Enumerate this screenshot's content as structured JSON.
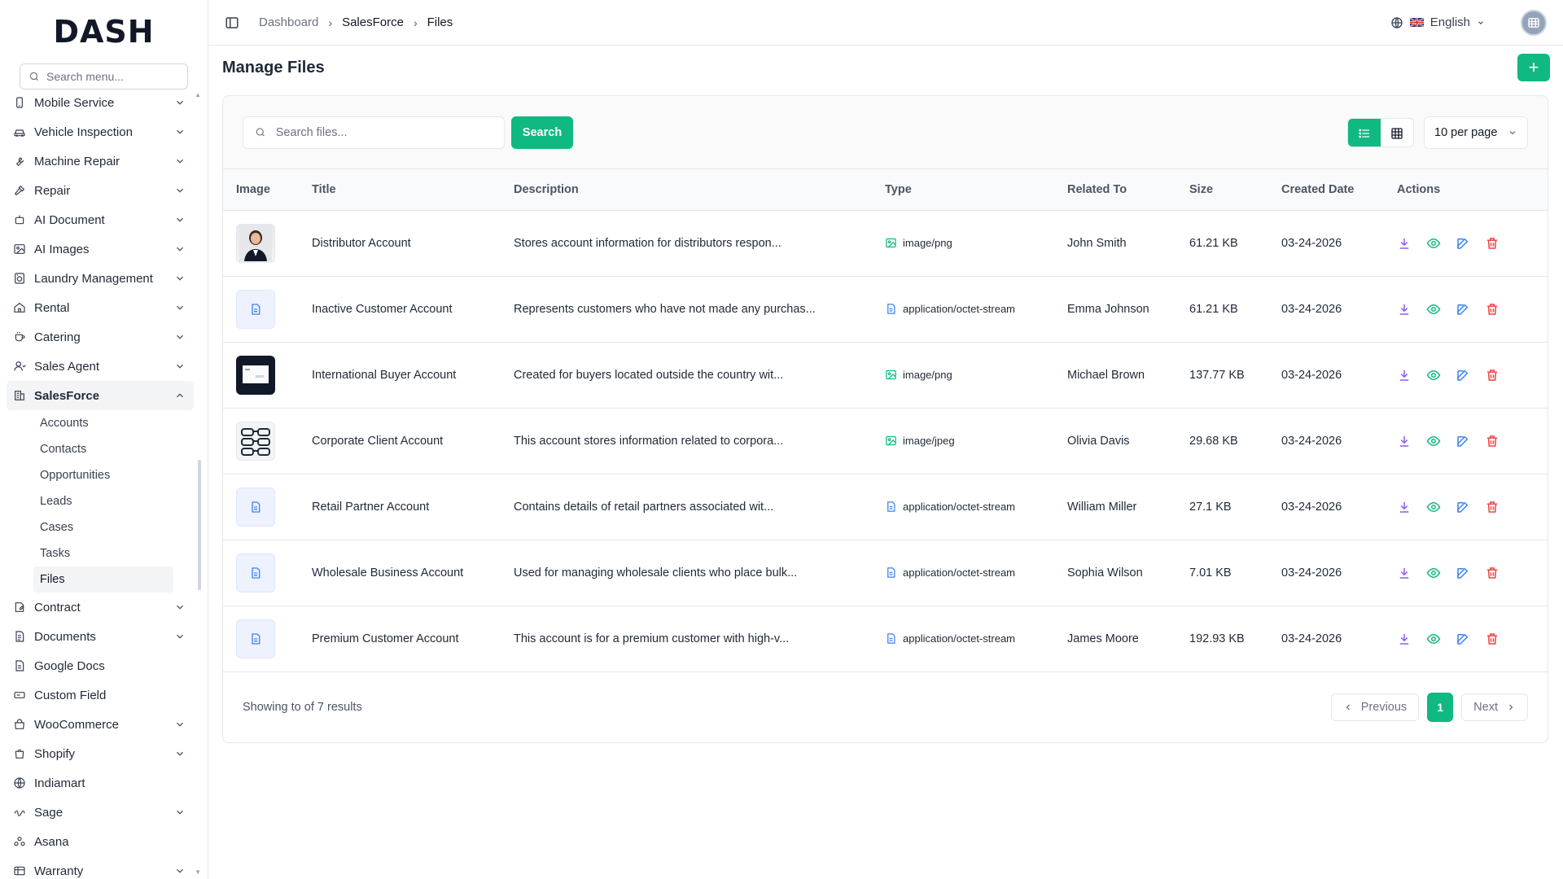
{
  "brand": {
    "logo_text": "DASH"
  },
  "sidebar": {
    "search_placeholder": "Search menu...",
    "items": [
      {
        "label": "Mobile Service",
        "icon": "phone-icon",
        "chevron": true
      },
      {
        "label": "Vehicle Inspection",
        "icon": "car-icon",
        "chevron": true
      },
      {
        "label": "Machine Repair",
        "icon": "wrench-icon",
        "chevron": true
      },
      {
        "label": "Repair",
        "icon": "hammer-icon",
        "chevron": true
      },
      {
        "label": "AI Document",
        "icon": "robot-icon",
        "chevron": true
      },
      {
        "label": "AI Images",
        "icon": "image-icon",
        "chevron": true
      },
      {
        "label": "Laundry Management",
        "icon": "washer-icon",
        "chevron": true
      },
      {
        "label": "Rental",
        "icon": "home-icon",
        "chevron": true
      },
      {
        "label": "Catering",
        "icon": "cup-icon",
        "chevron": true
      },
      {
        "label": "Sales Agent",
        "icon": "user-icon",
        "chevron": true
      },
      {
        "label": "SalesForce",
        "icon": "building-icon",
        "chevron": true,
        "expanded": true
      }
    ],
    "salesforce_sub": [
      "Accounts",
      "Contacts",
      "Opportunities",
      "Leads",
      "Cases",
      "Tasks",
      "Files"
    ],
    "items_after": [
      {
        "label": "Contract",
        "icon": "contract-icon",
        "chevron": true
      },
      {
        "label": "Documents",
        "icon": "document-icon",
        "chevron": true
      },
      {
        "label": "Google Docs",
        "icon": "doc-icon",
        "chevron": false
      },
      {
        "label": "Custom Field",
        "icon": "field-icon",
        "chevron": false
      },
      {
        "label": "WooCommerce",
        "icon": "store-icon",
        "chevron": true
      },
      {
        "label": "Shopify",
        "icon": "bag-icon",
        "chevron": true
      },
      {
        "label": "Indiamart",
        "icon": "globe-icon",
        "chevron": false
      },
      {
        "label": "Sage",
        "icon": "sage-icon",
        "chevron": true
      },
      {
        "label": "Asana",
        "icon": "asana-icon",
        "chevron": false
      },
      {
        "label": "Warranty",
        "icon": "warranty-icon",
        "chevron": true
      }
    ]
  },
  "topbar": {
    "breadcrumb": [
      "Dashboard",
      "SalesForce",
      "Files"
    ],
    "language": "English"
  },
  "page": {
    "title": "Manage Files",
    "add_label": "+"
  },
  "toolbar": {
    "search_placeholder": "Search files...",
    "search_label": "Search",
    "per_page": "10 per page"
  },
  "table": {
    "headers": [
      "Image",
      "Title",
      "Description",
      "Type",
      "Related To",
      "Size",
      "Created Date",
      "Actions"
    ],
    "rows": [
      {
        "thumb": "person",
        "title": "Distributor Account",
        "description": "Stores account information for distributors respon...",
        "type": "image/png",
        "type_icon": "image",
        "related": "John Smith",
        "size": "61.21 KB",
        "date": "03-24-2026"
      },
      {
        "thumb": "doc",
        "title": "Inactive Customer Account",
        "description": "Represents customers who have not made any purchas...",
        "type": "application/octet-stream",
        "type_icon": "file",
        "related": "Emma Johnson",
        "size": "61.21 KB",
        "date": "03-24-2026"
      },
      {
        "thumb": "screen",
        "title": "International Buyer Account",
        "description": "Created for buyers located outside the country wit...",
        "type": "image/png",
        "type_icon": "image",
        "related": "Michael Brown",
        "size": "137.77 KB",
        "date": "03-24-2026"
      },
      {
        "thumb": "glasses",
        "title": "Corporate Client Account",
        "description": "This account stores information related to corpora...",
        "type": "image/jpeg",
        "type_icon": "image",
        "related": "Olivia Davis",
        "size": "29.68 KB",
        "date": "03-24-2026"
      },
      {
        "thumb": "doc",
        "title": "Retail Partner Account",
        "description": "Contains details of retail partners associated wit...",
        "type": "application/octet-stream",
        "type_icon": "file",
        "related": "William Miller",
        "size": "27.1 KB",
        "date": "03-24-2026"
      },
      {
        "thumb": "doc",
        "title": "Wholesale Business Account",
        "description": "Used for managing wholesale clients who place bulk...",
        "type": "application/octet-stream",
        "type_icon": "file",
        "related": "Sophia Wilson",
        "size": "7.01 KB",
        "date": "03-24-2026"
      },
      {
        "thumb": "doc",
        "title": "Premium Customer Account",
        "description": "This account is for a premium customer with high-v...",
        "type": "application/octet-stream",
        "type_icon": "file",
        "related": "James Moore",
        "size": "192.93 KB",
        "date": "03-24-2026"
      }
    ]
  },
  "footer": {
    "showing": "Showing to of 7 results",
    "prev": "Previous",
    "page": "1",
    "next": "Next"
  },
  "colors": {
    "accent": "#10b981",
    "download": "#8b5cf6",
    "view": "#10b981",
    "edit": "#3b82f6",
    "delete": "#ef4444"
  }
}
